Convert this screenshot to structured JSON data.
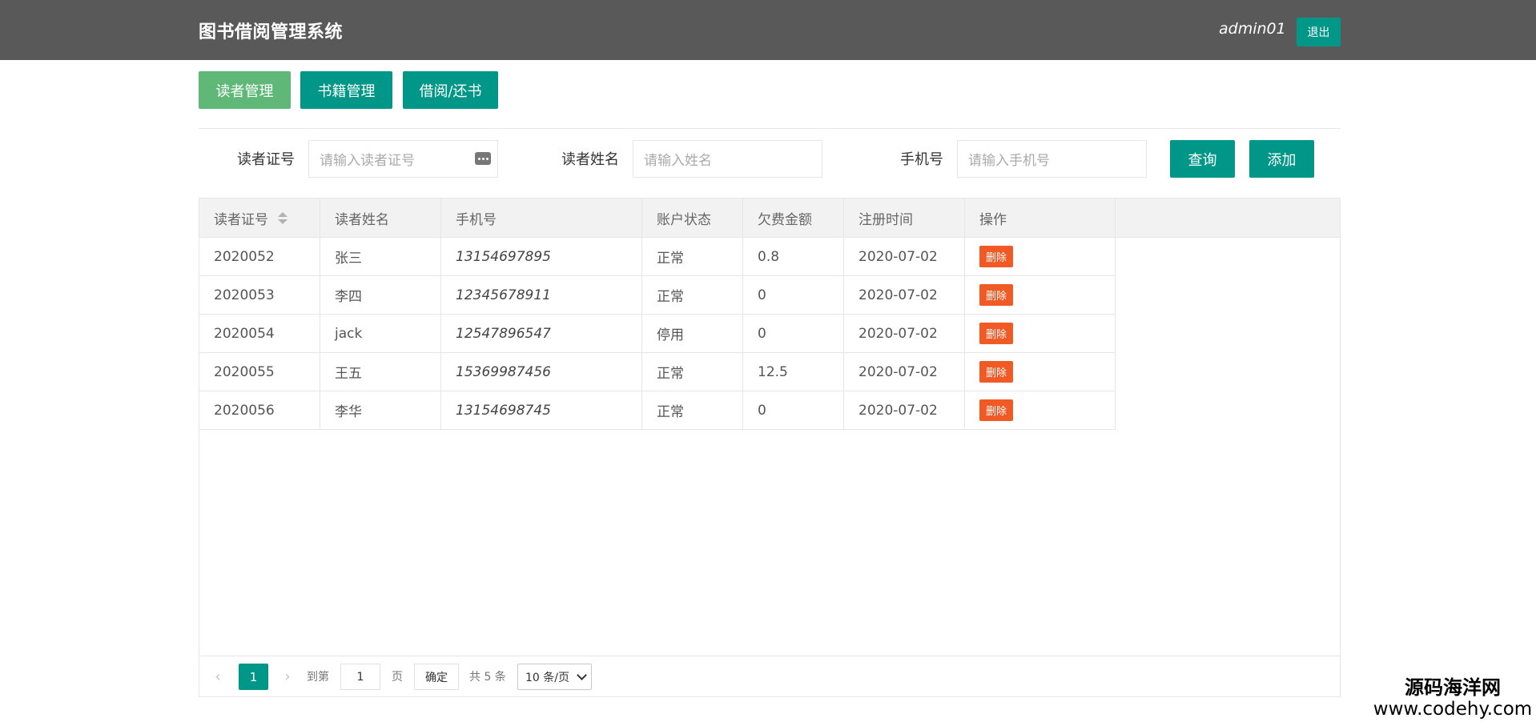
{
  "header": {
    "title": "图书借阅管理系统",
    "username": "admin01",
    "logout_label": "退出"
  },
  "nav": [
    {
      "label": "读者管理",
      "active": true
    },
    {
      "label": "书籍管理",
      "active": false
    },
    {
      "label": "借阅/还书",
      "active": false
    }
  ],
  "filters": {
    "card_label": "读者证号",
    "card_placeholder": "请输入读者证号",
    "name_label": "读者姓名",
    "name_placeholder": "请输入姓名",
    "phone_label": "手机号",
    "phone_placeholder": "请输入手机号",
    "query_label": "查询",
    "add_label": "添加"
  },
  "table": {
    "columns": [
      "读者证号",
      "读者姓名",
      "手机号",
      "账户状态",
      "欠费金额",
      "注册时间",
      "操作"
    ],
    "delete_label": "删除",
    "rows": [
      {
        "card": "2020052",
        "name": "张三",
        "phone": "13154697895",
        "status": "正常",
        "debt": "0.8",
        "reg": "2020-07-02"
      },
      {
        "card": "2020053",
        "name": "李四",
        "phone": "12345678911",
        "status": "正常",
        "debt": "0",
        "reg": "2020-07-02"
      },
      {
        "card": "2020054",
        "name": "jack",
        "phone": "12547896547",
        "status": "停用",
        "debt": "0",
        "reg": "2020-07-02"
      },
      {
        "card": "2020055",
        "name": "王五",
        "phone": "15369987456",
        "status": "正常",
        "debt": "12.5",
        "reg": "2020-07-02"
      },
      {
        "card": "2020056",
        "name": "李华",
        "phone": "13154698745",
        "status": "正常",
        "debt": "0",
        "reg": "2020-07-02"
      }
    ]
  },
  "pagination": {
    "current_page": "1",
    "goto_prefix": "到第",
    "goto_value": "1",
    "goto_suffix": "页",
    "confirm_label": "确定",
    "total_text": "共 5 条",
    "page_size": "10 条/页"
  },
  "watermark": {
    "title": "源码海洋网",
    "url": "www.codehy.com"
  },
  "colors": {
    "header_bg": "#595959",
    "primary": "#009688",
    "active_nav": "#5fb878",
    "danger": "#f15a24"
  }
}
